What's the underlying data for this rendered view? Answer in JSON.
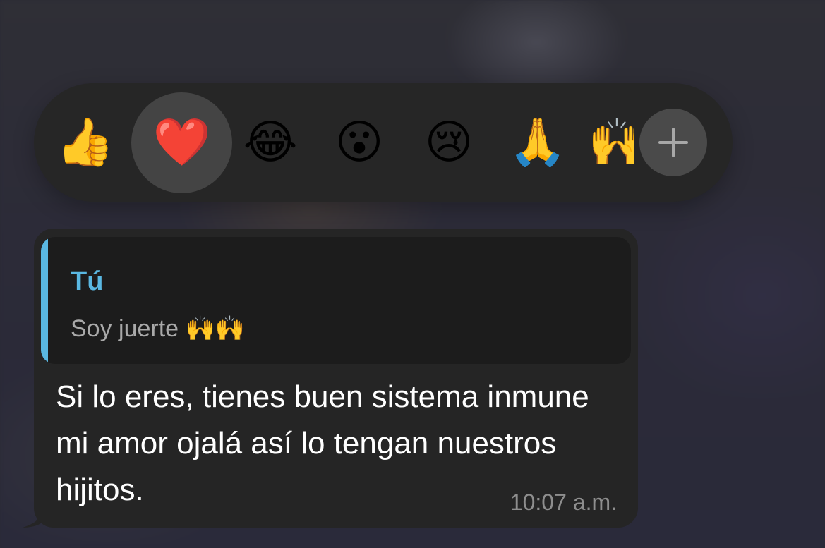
{
  "reactions": {
    "thumbs_up": "👍",
    "heart": "❤️",
    "laughing": "😂",
    "surprised": "😮",
    "crying": "😢",
    "praying": "🙏",
    "raised_hand": "🙌"
  },
  "message": {
    "quote_author": "Tú",
    "quote_text": "Soy juerte 🙌🙌",
    "text": "Si lo eres, tienes buen sistema inmune mi amor ojalá así lo tengan nuestros hijitos.",
    "time": "10:07 a.m."
  },
  "colors": {
    "accent": "#5ab8e2",
    "bubble": "#252525",
    "quote_bg": "#1c1c1c",
    "reaction_bar": "#262626"
  }
}
